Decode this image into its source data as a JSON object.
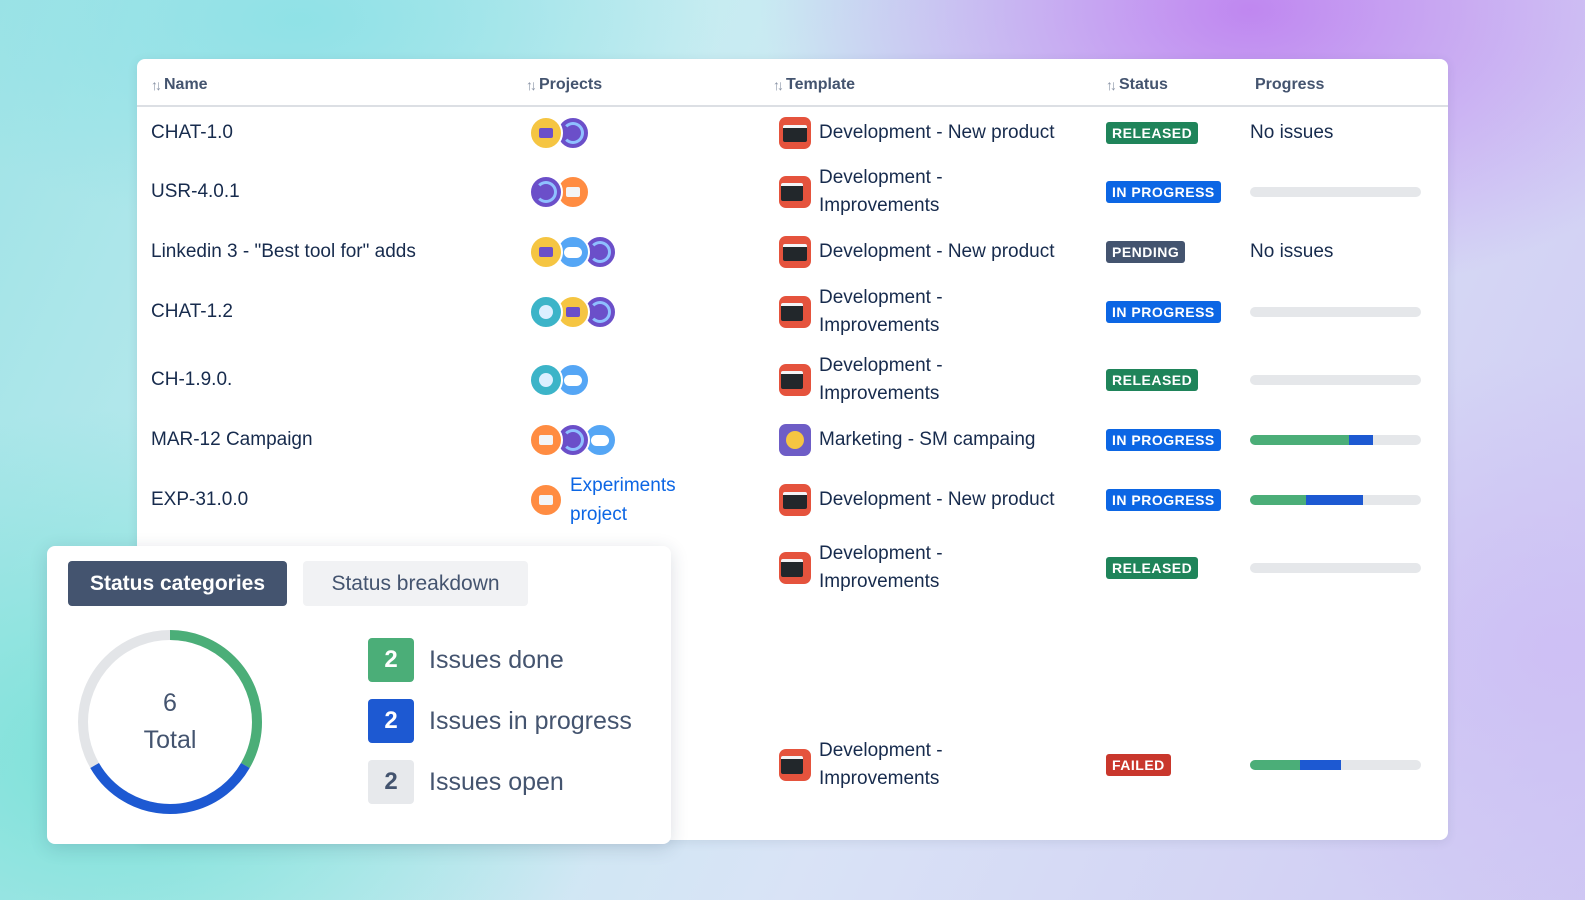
{
  "table": {
    "headers": {
      "name": "Name",
      "projects": "Projects",
      "template": "Template",
      "status": "Status",
      "progress": "Progress"
    },
    "rows": [
      {
        "name": "CHAT-1.0",
        "projects": [
          "yellow",
          "purple"
        ],
        "template": "Development - New product",
        "template_icon": "dev-window-icon",
        "status": "RELEASED",
        "status_kind": "released",
        "progress_text": "No issues"
      },
      {
        "name": "USR-4.0.1",
        "projects": [
          "purple",
          "orange"
        ],
        "template_lines": [
          "Development -",
          "Improvements"
        ],
        "template_icon": "dev-list-icon",
        "status": "IN PROGRESS",
        "status_kind": "inprogress",
        "progress": {
          "done": 0,
          "in_progress": 0
        }
      },
      {
        "name": "Linkedin 3 - \"Best tool for\" adds",
        "projects": [
          "yellow",
          "sky",
          "purple"
        ],
        "template": "Development - New product",
        "template_icon": "dev-window-icon",
        "status": "PENDING",
        "status_kind": "pending",
        "progress_text": "No issues"
      },
      {
        "name": "CHAT-1.2",
        "projects": [
          "teal",
          "yellow",
          "purple"
        ],
        "template_lines": [
          "Development -",
          "Improvements"
        ],
        "template_icon": "dev-list-icon",
        "status": "IN PROGRESS",
        "status_kind": "inprogress",
        "progress": {
          "done": 0,
          "in_progress": 0
        }
      },
      {
        "name": "CH-1.9.0.",
        "projects": [
          "teal",
          "sky"
        ],
        "template_lines": [
          "Development -",
          "Improvements"
        ],
        "template_icon": "dev-list-icon",
        "status": "RELEASED",
        "status_kind": "released",
        "progress": {
          "done": 0,
          "in_progress": 0
        }
      },
      {
        "name": "MAR-12 Campaign",
        "projects": [
          "orange",
          "purple",
          "sky"
        ],
        "template": "Marketing - SM campaing",
        "template_icon": "marketing-icon",
        "status": "IN PROGRESS",
        "status_kind": "inprogress",
        "progress": {
          "done": 0.58,
          "in_progress": 0.14
        }
      },
      {
        "name": "EXP-31.0.0",
        "projects": [
          "orange"
        ],
        "project_link_lines": [
          "Experiments",
          "project"
        ],
        "template": "Development - New product",
        "template_icon": "dev-window-icon",
        "status": "IN PROGRESS",
        "status_kind": "inprogress",
        "progress": {
          "done": 0.33,
          "in_progress": 0.33
        }
      },
      {
        "name": "",
        "projects": [],
        "template_lines": [
          "Development -",
          "Improvements"
        ],
        "template_icon": "dev-list-icon",
        "status": "RELEASED",
        "status_kind": "released",
        "progress": {
          "done": 0,
          "in_progress": 0
        }
      },
      {
        "name": "",
        "projects": [],
        "template_lines": [
          "Development -",
          "Improvements"
        ],
        "template_icon": "dev-list-icon",
        "status": "FAILED",
        "status_kind": "failed",
        "progress": {
          "done": 0.29,
          "in_progress": 0.24
        }
      }
    ]
  },
  "status_panel": {
    "tabs": [
      "Status categories",
      "Status breakdown"
    ],
    "active_tab": 0,
    "total_value": "6",
    "total_label": "Total",
    "legend": [
      {
        "count": "2",
        "label": "Issues done",
        "kind": "done"
      },
      {
        "count": "2",
        "label": "Issues in progress",
        "kind": "prog"
      },
      {
        "count": "2",
        "label": "Issues open",
        "kind": "open"
      }
    ]
  },
  "colors": {
    "done": "#4bae78",
    "in_progress": "#1d59d2",
    "open": "#e3e5e8",
    "released": "#1f845a",
    "in_progress_lozenge": "#0c66e4",
    "pending": "#44546f",
    "failed": "#c9372c"
  },
  "icons": {
    "sort": "sort-arrows-icon",
    "templates": [
      "dev-window-icon",
      "dev-list-icon",
      "marketing-icon"
    ]
  }
}
